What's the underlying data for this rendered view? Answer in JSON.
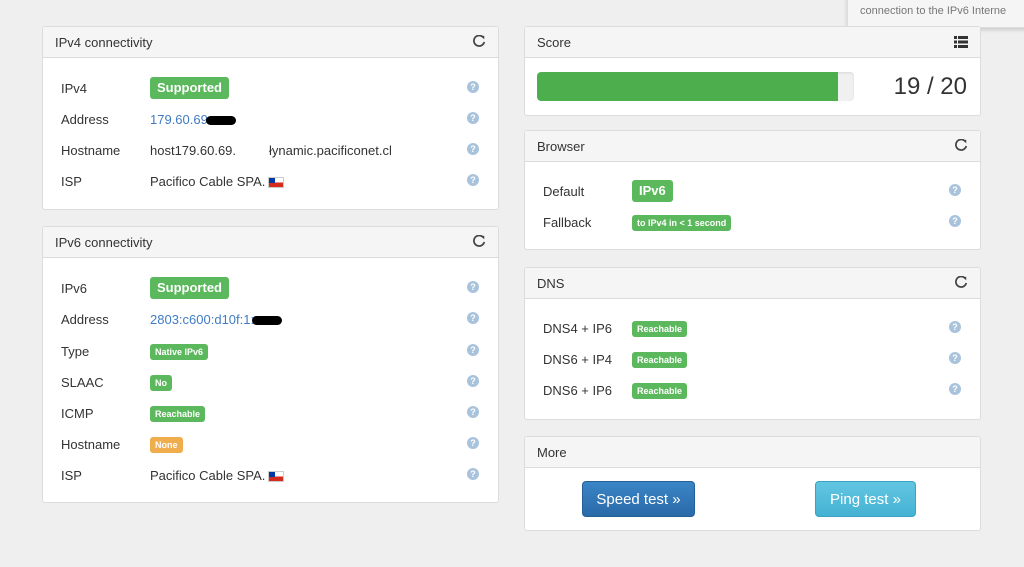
{
  "tooltip": {
    "text": "connection to the IPv6 Interne"
  },
  "ipv4": {
    "title": "IPv4 connectivity",
    "rows": [
      {
        "label": "IPv4",
        "badge": "Supported"
      },
      {
        "label": "Address",
        "value": "179.60.69"
      },
      {
        "label": "Hostname",
        "value": "host179.60.69.",
        "value2": "łynamic.pacificonet.cl"
      },
      {
        "label": "ISP",
        "value": "Pacifico Cable SPA."
      }
    ]
  },
  "ipv6": {
    "title": "IPv6 connectivity",
    "rows": [
      {
        "label": "IPv6",
        "badge": "Supported"
      },
      {
        "label": "Address",
        "value": "2803:c600:d10f:1:"
      },
      {
        "label": "Type",
        "badge": "Native IPv6"
      },
      {
        "label": "SLAAC",
        "badge": "No"
      },
      {
        "label": "ICMP",
        "badge": "Reachable"
      },
      {
        "label": "Hostname",
        "badge": "None"
      },
      {
        "label": "ISP",
        "value": "Pacifico Cable SPA."
      }
    ]
  },
  "score": {
    "title": "Score",
    "text": "19 / 20",
    "progress": 0.95,
    "bar_color": "#4cae4c"
  },
  "browser": {
    "title": "Browser",
    "rows": [
      {
        "label": "Default",
        "badge": "IPv6"
      },
      {
        "label": "Fallback",
        "badge": "to IPv4 in < 1 second"
      }
    ]
  },
  "dns": {
    "title": "DNS",
    "rows": [
      {
        "label": "DNS4 + IP6",
        "badge": "Reachable"
      },
      {
        "label": "DNS6 + IP4",
        "badge": "Reachable"
      },
      {
        "label": "DNS6 + IP6",
        "badge": "Reachable"
      }
    ]
  },
  "more": {
    "title": "More",
    "speed_test": "Speed test »",
    "ping_test": "Ping test »"
  },
  "help_icon": "?",
  "colors": {
    "success": "#5cb85c",
    "warning": "#f0ad4e",
    "primary": "#337ab7",
    "info": "#5bc0de",
    "link": "#3f7cc4"
  }
}
